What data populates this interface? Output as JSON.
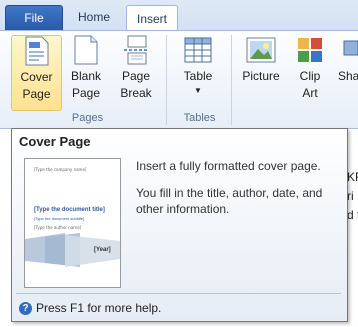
{
  "tabs": {
    "file": "File",
    "home": "Home",
    "insert": "Insert"
  },
  "ribbon": {
    "groups": {
      "pages": "Pages",
      "tables": "Tables"
    },
    "buttons": {
      "cover_page": [
        "Cover",
        "Page"
      ],
      "blank_page": [
        "Blank",
        "Page"
      ],
      "page_break": [
        "Page",
        "Break"
      ],
      "table": "Table",
      "picture": "Picture",
      "clip_art": [
        "Clip",
        "Art"
      ],
      "shapes_partial": "Sha"
    }
  },
  "tooltip": {
    "title": "Cover Page",
    "description_1": "Insert a fully formatted cover page.",
    "description_2": "You fill in the title, author, date, and other information.",
    "help": "Press F1 for more help.",
    "thumbnail": {
      "top_line": "[Type the company name]",
      "doc_title": "[Type the document title]",
      "doc_subtitle": "[Type the document subtitle]",
      "author_line": "[Type the author name]",
      "year": "[Year]"
    }
  },
  "document_edge": {
    "lines": [
      "KRi",
      "ri",
      "d t"
    ]
  },
  "colors": {
    "file_tab": "#2a5aa8",
    "active_button": "#ffe28e",
    "accent": "#2f6bc1"
  }
}
